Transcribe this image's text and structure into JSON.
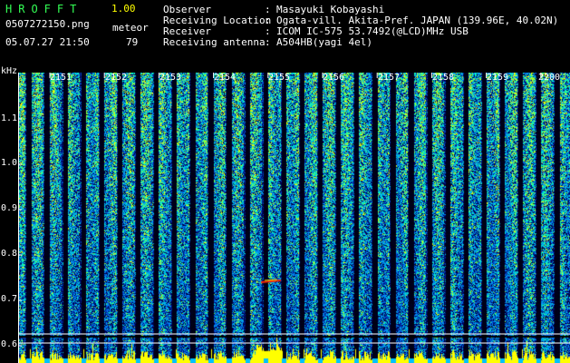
{
  "app": {
    "title": "HROFFT",
    "version": "1.00"
  },
  "file": {
    "name": "0507272150.png",
    "datetime": "05.07.27 21:50"
  },
  "detection": {
    "mode_label": "meteor",
    "count": "79"
  },
  "info": [
    {
      "label": "Observer",
      "value": "Masayuki Kobayashi"
    },
    {
      "label": "Receiving Location",
      "value": "Ogata-vill. Akita-Pref. JAPAN (139.96E, 40.02N)"
    },
    {
      "label": "Receiver",
      "value": "ICOM IC-575 53.7492(@LCD)MHz USB"
    },
    {
      "label": "Receiving antenna",
      "value": "A504HB(yagi 4el)"
    }
  ],
  "info_separator": ":",
  "spectrogram": {
    "y_unit": "kHz",
    "y_ticks": [
      "1.1",
      "1.0",
      "0.9",
      "0.8",
      "0.7",
      "0.6"
    ],
    "y_values": [
      1.1,
      1.0,
      0.9,
      0.8,
      0.7,
      0.6
    ],
    "x_ticks": [
      "2151",
      "2152",
      "2153",
      "2154",
      "2155",
      "2156",
      "2157",
      "2158",
      "2159",
      "2200"
    ],
    "grid_color": "#ffffff",
    "lower_band_color": "#ffff00",
    "accent_colors": {
      "low": "#000070",
      "mid": "#00c0ff",
      "high": "#ffff00",
      "echo": "#ff0000"
    }
  }
}
